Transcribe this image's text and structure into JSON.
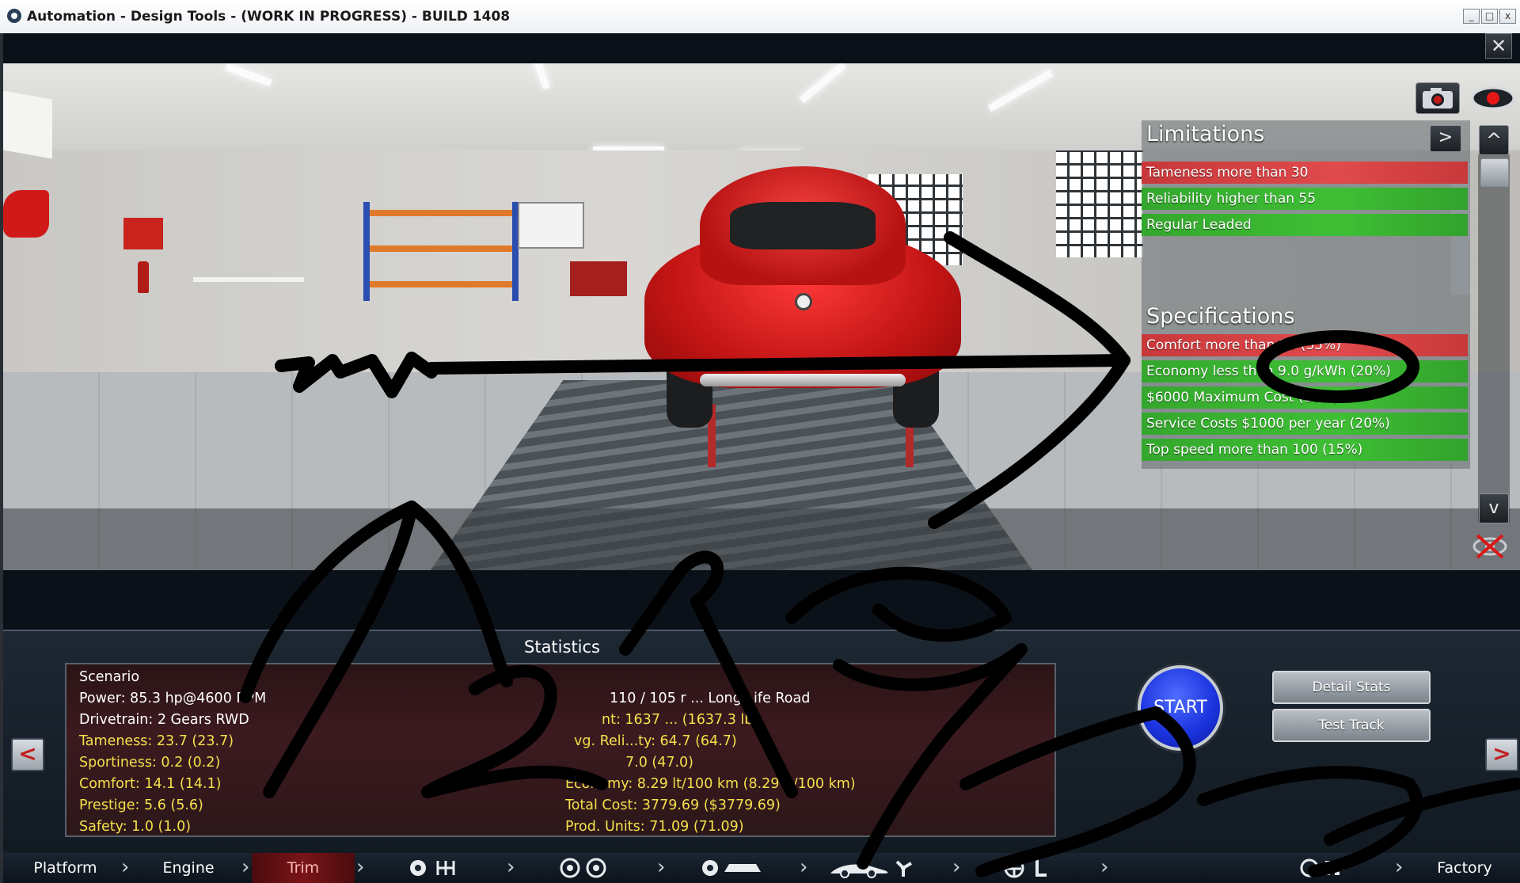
{
  "window": {
    "title": "Automation - Design Tools - (WORK IN PROGRESS) - BUILD 1408",
    "minimize": "_",
    "maximize": "□",
    "close": "x"
  },
  "game": {
    "close_label": "✕",
    "icons": {
      "camera": "camera-icon",
      "eye": "eye-icon",
      "hide": "hide-overlay-icon"
    },
    "limitations": {
      "title": "Limitations",
      "next_label": ">",
      "items": [
        {
          "label": "Tameness more than 30",
          "status": "fail",
          "color": "#d84345"
        },
        {
          "label": "Reliability higher than 55",
          "status": "pass",
          "color": "#3bb531"
        },
        {
          "label": "Regular Leaded",
          "status": "pass",
          "color": "#3bb531"
        }
      ]
    },
    "specifications": {
      "title": "Specifications",
      "items": [
        {
          "label": "Comfort more than 25 (35%)",
          "status": "fail",
          "color": "#d84345"
        },
        {
          "label": "Economy less than 9.0 g/kWh (20%)",
          "status": "pass",
          "color": "#3bb531"
        },
        {
          "label": "$6000 Maximum Cost (10%)",
          "status": "pass",
          "color": "#3bb531"
        },
        {
          "label": "Service Costs $1000 per year (20%)",
          "status": "pass",
          "color": "#3bb531"
        },
        {
          "label": "Top speed more than 100 (15%)",
          "status": "pass",
          "color": "#3bb531"
        }
      ]
    },
    "scroll": {
      "up": "^",
      "down": "v"
    },
    "statistics": {
      "title": "Statistics",
      "left": [
        {
          "text": "Scenario",
          "color": "white"
        },
        {
          "text": "Power: 85.3 hp@4600 RPM",
          "color": "white"
        },
        {
          "text": "Drivetrain: 2 Gears RWD",
          "color": "white"
        },
        {
          "text": "Tameness: 23.7 (23.7)",
          "color": "yellow"
        },
        {
          "text": "Sportiness: 0.2 (0.2)",
          "color": "yellow"
        },
        {
          "text": "Comfort: 14.1 (14.1)",
          "color": "yellow"
        },
        {
          "text": "Prestige: 5.6 (5.6)",
          "color": "yellow"
        },
        {
          "text": "Safety: 1.0 (1.0)",
          "color": "yellow"
        }
      ],
      "right": [
        {
          "text": "110 / 105 r ... Long Life Road",
          "color": "white"
        },
        {
          "text": "nt: 1637 ... (1637.3 lb)",
          "color": "yellow"
        },
        {
          "text": "vg. Reli...ty: 64.7 (64.7)",
          "color": "yellow"
        },
        {
          "text": "7.0 (47.0)",
          "color": "yellow"
        },
        {
          "text": "Economy: 8.29 lt/100 km (8.29 lt/100 km)",
          "color": "yellow"
        },
        {
          "text": "Total Cost: 3779.69 ($3779.69)",
          "color": "yellow"
        },
        {
          "text": "Prod. Units: 71.09 (71.09)",
          "color": "yellow"
        }
      ]
    },
    "buttons": {
      "start": "START",
      "detail_stats": "Detail Stats",
      "test_track": "Test Track",
      "prev": "<",
      "next": ">"
    },
    "tabs": {
      "platform": "Platform",
      "engine": "Engine",
      "trim": "Trim",
      "factory": "Factory",
      "icon_names": [
        "gearbox-icon",
        "wheels-icon",
        "body-icon",
        "car-aero-icon",
        "cooling-fan-icon",
        "interior-icon",
        "race-flag-icon"
      ]
    }
  },
  "colors": {
    "accent_blue": "#1c35e0",
    "fail_red": "#d84345",
    "pass_green": "#3bb531",
    "stat_yellow": "#f4e04a"
  }
}
